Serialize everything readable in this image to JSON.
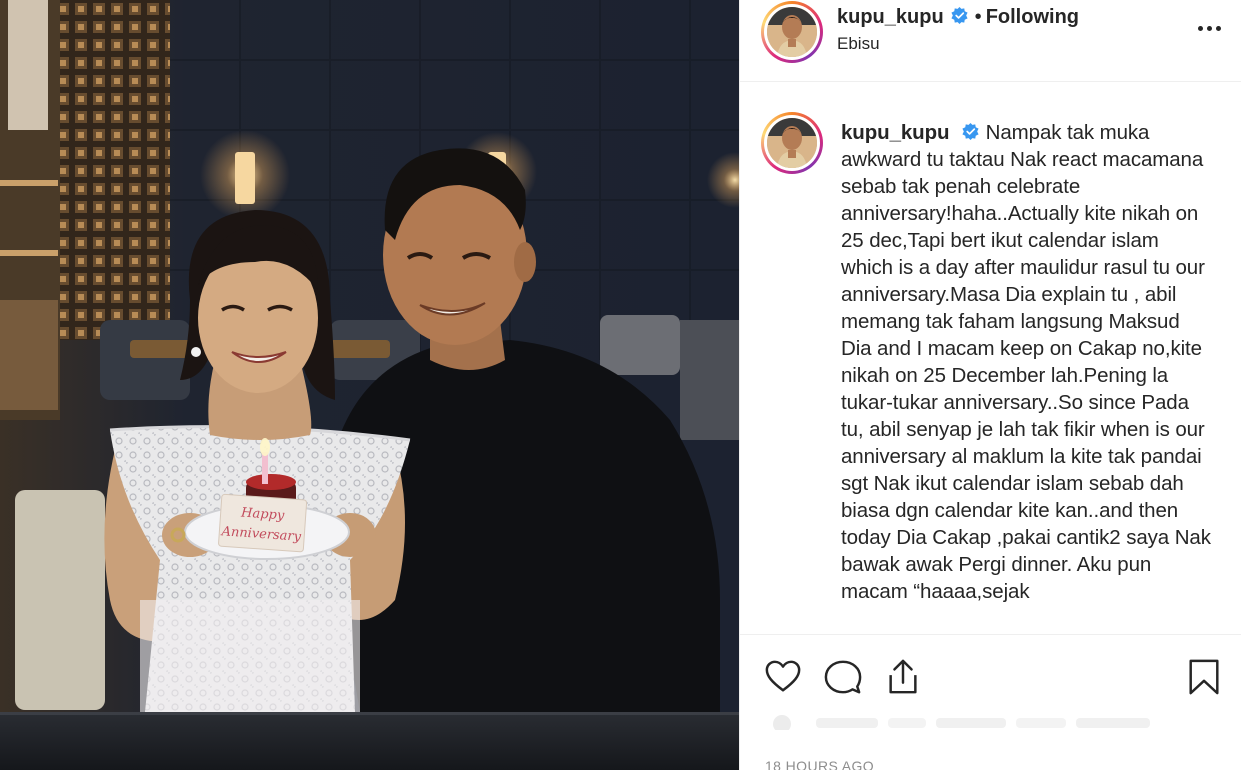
{
  "post": {
    "username": "kupu_kupu",
    "follow_status": "Following",
    "separator": "•",
    "location": "Ebisu",
    "verified": true
  },
  "photo": {
    "cake_text_line1": "Happy",
    "cake_text_line2": "Anniversary"
  },
  "caption": {
    "username": "kupu_kupu",
    "text": "Nampak tak muka awkward tu taktau Nak react macamana sebab tak penah celebrate anniversary!haha..Actually kite nikah on 25 dec,Tapi bert ikut calendar islam which is a day after maulidur rasul tu our anniversary.Masa Dia explain tu , abil memang tak faham langsung Maksud Dia and I macam keep on Cakap no,kite nikah on 25 December lah.Pening la tukar-tukar anniversary..So since Pada tu, abil senyap je lah tak fikir when is our anniversary al maklum la kite tak pandai sgt Nak ikut calendar islam sebab dah biasa dgn calendar kite kan..and then today Dia Cakap ,pakai cantik2 saya Nak bawak awak Pergi dinner. Aku pun macam “haaaa,sejak"
  },
  "timestamp": "18 HOURS AGO",
  "icons": {
    "like": "heart-icon",
    "comment": "comment-icon",
    "share": "share-icon",
    "save": "bookmark-icon",
    "more": "more-options-icon",
    "verified": "verified-badge-icon"
  },
  "colors": {
    "text": "#262626",
    "muted": "#8e8e8e",
    "verified": "#3897f0",
    "divider": "#efefef"
  }
}
